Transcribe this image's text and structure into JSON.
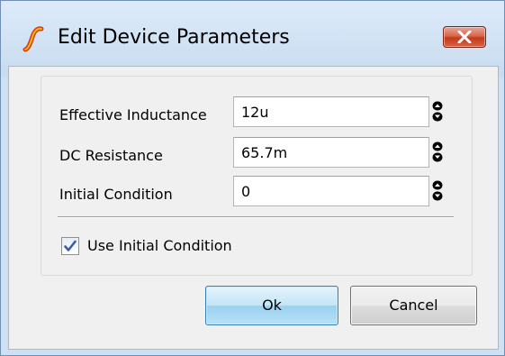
{
  "window": {
    "title": "Edit Device Parameters",
    "app_icon": "simetrix-logo-icon",
    "close_icon": "close-icon"
  },
  "parameters": [
    {
      "label": "Effective Inductance",
      "value": "12u"
    },
    {
      "label": "DC Resistance",
      "value": "65.7m"
    },
    {
      "label": "Initial Condition",
      "value": "0"
    }
  ],
  "options": {
    "use_initial_condition_label": "Use Initial Condition",
    "use_initial_condition_checked": true
  },
  "buttons": {
    "ok_label": "Ok",
    "cancel_label": "Cancel"
  },
  "colors": {
    "title_bar": "#dcebfa",
    "dialog_bg": "#f0f0f0",
    "close_button": "#c3391c",
    "default_button": "#98d1ef"
  }
}
